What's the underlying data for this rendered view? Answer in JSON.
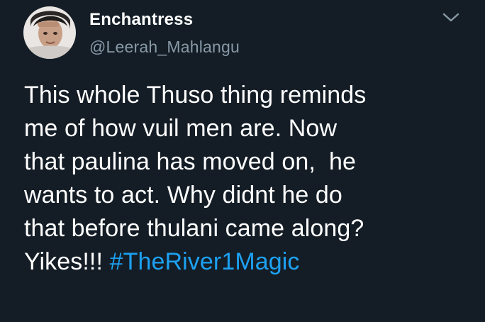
{
  "tweet": {
    "display_name": "Enchantress",
    "handle": "@Leerah_Mahlangu",
    "menu_icon": "chevron-down-icon",
    "avatar_icon": "avatar",
    "lines": [
      "This whole Thuso thing reminds",
      "me of how vuil men are. Now",
      "that paulina has moved on,  he",
      "wants to act. Why didnt he do",
      "that before thulani came along?"
    ],
    "last_line_text": "Yikes!!! ",
    "hashtag": "#TheRiver1Magic"
  },
  "colors": {
    "background": "#141d26",
    "text": "#ffffff",
    "secondary_text": "#8899a6",
    "link": "#1da1f2"
  }
}
